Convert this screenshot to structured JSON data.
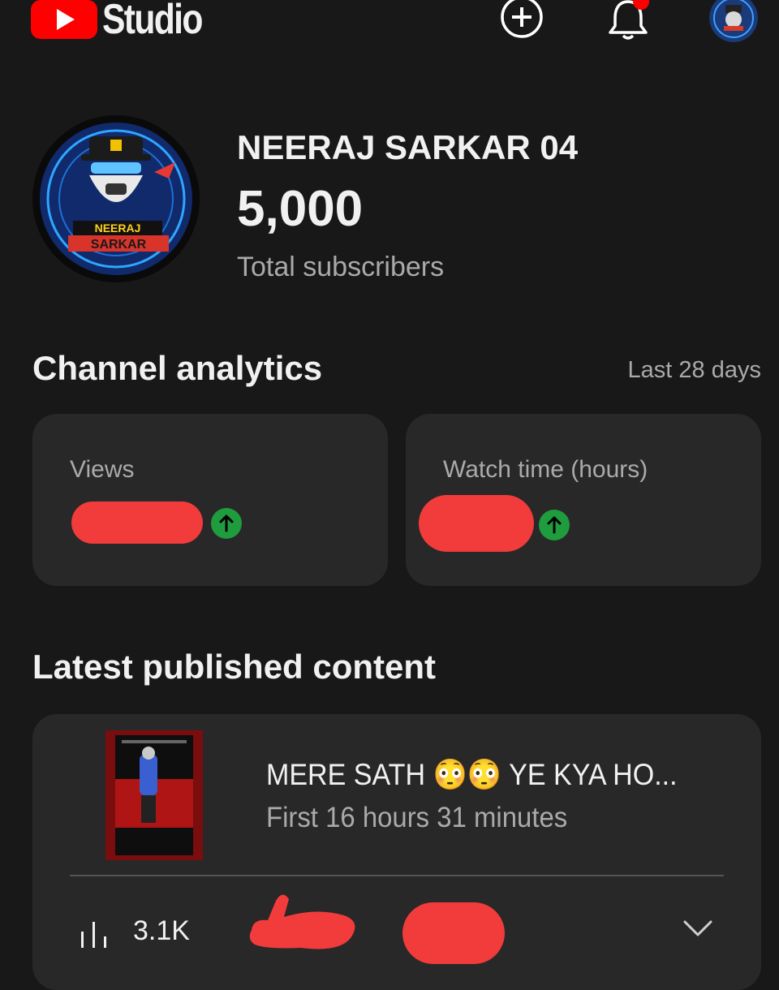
{
  "header": {
    "app_name": "Studio",
    "icons": {
      "logo": "youtube-play-icon",
      "create": "plus-circle-icon",
      "notifications": "bell-icon",
      "account": "avatar"
    }
  },
  "channel": {
    "name": "NEERAJ SARKAR 04",
    "subscriber_count": "5,000",
    "subscriber_label": "Total subscribers",
    "logo_text_line1": "NEERAJ",
    "logo_text_line2": "SARKAR"
  },
  "analytics": {
    "title": "Channel analytics",
    "range": "Last 28 days",
    "cards": [
      {
        "label": "Views",
        "trend": "up"
      },
      {
        "label": "Watch time (hours)",
        "trend": "up"
      }
    ]
  },
  "latest": {
    "title": "Latest published content",
    "video_title": "MERE SATH 😳😳 YE KYA HO...",
    "video_subtitle": "First 16 hours 31 minutes",
    "views": "3.1K"
  },
  "colors": {
    "background": "#181818",
    "card": "#282828",
    "accent_red": "#ff0000",
    "trend_green": "#1f9c3e",
    "secondary_text": "#aaaaaa"
  }
}
